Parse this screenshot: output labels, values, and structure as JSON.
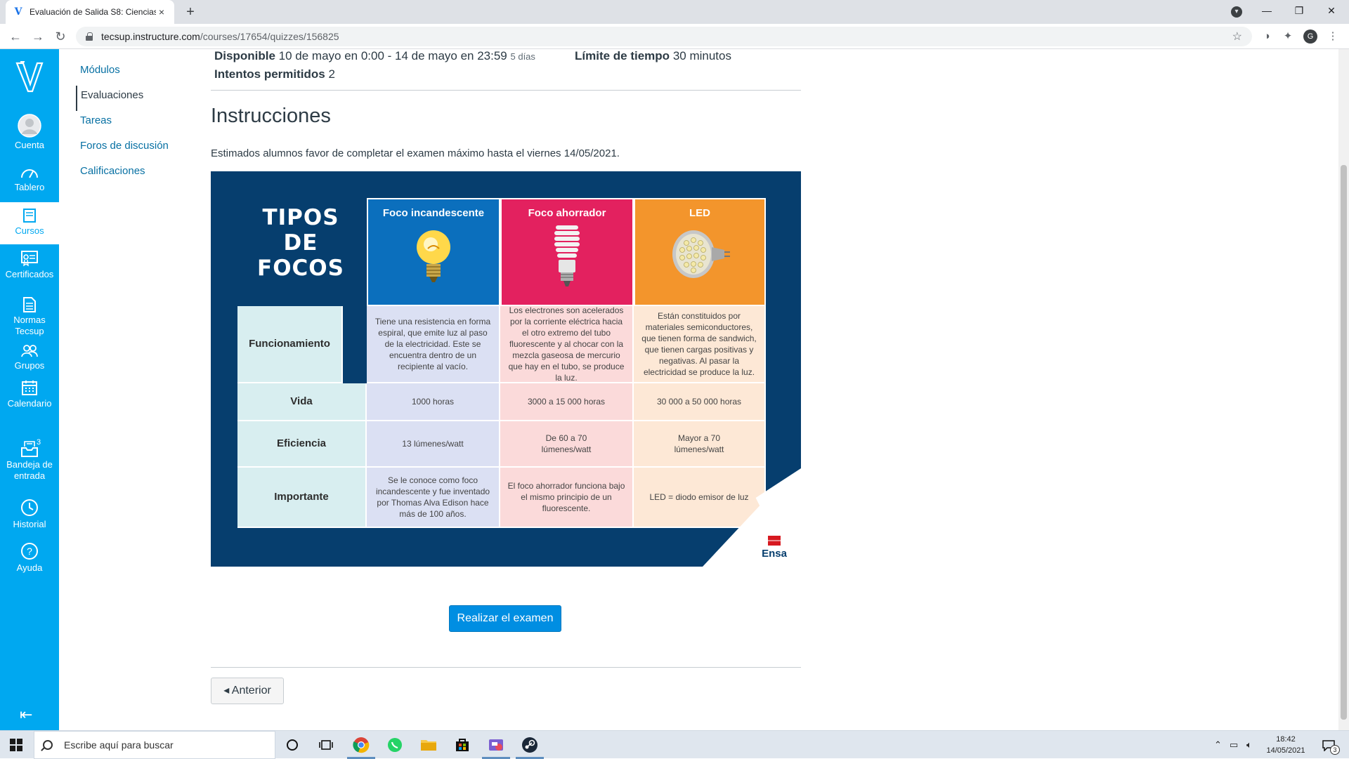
{
  "browser": {
    "tab_title": "Evaluación de Salida S8: Ciencias",
    "tab_close": "×",
    "new_tab": "+",
    "url_domain": "tecsup.instructure.com",
    "url_path": "/courses/17654/quizzes/156825",
    "profile_initial": "G"
  },
  "global_nav": {
    "items": [
      {
        "label": "Cuenta"
      },
      {
        "label": "Tablero"
      },
      {
        "label": "Cursos"
      },
      {
        "label": "Certificados"
      },
      {
        "label": "Normas Tecsup"
      },
      {
        "label": "Grupos"
      },
      {
        "label": "Calendario"
      },
      {
        "label": "Bandeja de entrada",
        "badge": "3"
      },
      {
        "label": "Historial"
      },
      {
        "label": "Ayuda"
      }
    ],
    "active": "Cursos"
  },
  "course_nav": {
    "items": [
      "Módulos",
      "Evaluaciones",
      "Tareas",
      "Foros de discusión",
      "Calificaciones"
    ],
    "active": "Evaluaciones"
  },
  "quiz": {
    "available_label": "Disponible",
    "available_value": "10 de mayo en 0:00 - 14 de mayo en 23:59",
    "available_days": "5 días",
    "time_limit_label": "Límite de tiempo",
    "time_limit_value": "30 minutos",
    "attempts_label": "Intentos permitidos",
    "attempts_value": "2",
    "instructions_heading": "Instrucciones",
    "instructions_text": "Estimados alumnos favor de completar el examen máximo hasta el viernes 14/05/2021.",
    "take_quiz_button": "Realizar el examen",
    "previous_button": "◂ Anterior"
  },
  "infographic": {
    "title_line1": "TIPOS",
    "title_line2": "DE",
    "title_line3": "FOCOS",
    "columns": [
      "Foco incandescente",
      "Foco ahorrador",
      "LED"
    ],
    "column_colors": [
      "#0b6fbd",
      "#e3215f",
      "#f3952c"
    ],
    "rows": [
      {
        "label": "Funcionamiento",
        "values": [
          "Tiene una resistencia en forma espiral, que emite luz al paso de la electricidad. Este se encuentra dentro de un recipiente al vacío.",
          "Los electrones son acelerados por la corriente eléctrica hacia el otro extremo del tubo fluorescente y al chocar con la mezcla gaseosa de mercurio que hay en el tubo, se produce la luz.",
          "Están constituidos por materiales semiconductores, que tienen forma de sandwich, que tienen cargas positivas y negativas. Al pasar la electricidad se produce la luz."
        ]
      },
      {
        "label": "Vida",
        "values": [
          "1000 horas",
          "3000 a 15 000 horas",
          "30 000 a 50 000 horas"
        ]
      },
      {
        "label": "Eficiencia",
        "values": [
          "13 lúmenes/watt",
          "De 60 a 70 lúmenes/watt",
          "Mayor a 70 lúmenes/watt"
        ]
      },
      {
        "label": "Importante",
        "values": [
          "Se le conoce como foco incandescente y fue inventado por Thomas Alva Edison hace más de 100 años.",
          "El foco ahorrador funciona bajo el mismo principio de un fluorescente.",
          "LED = diodo emisor de luz"
        ]
      }
    ],
    "brand": "Ensa"
  },
  "taskbar": {
    "search_placeholder": "Escribe aquí para buscar",
    "time": "18:42",
    "date": "14/05/2021",
    "notification_count": "3"
  },
  "colors": {
    "canvas_nav": "#00a8f0",
    "link": "#0770a3",
    "primary_button": "#008ee2",
    "infographic_bg": "#063e6e"
  }
}
